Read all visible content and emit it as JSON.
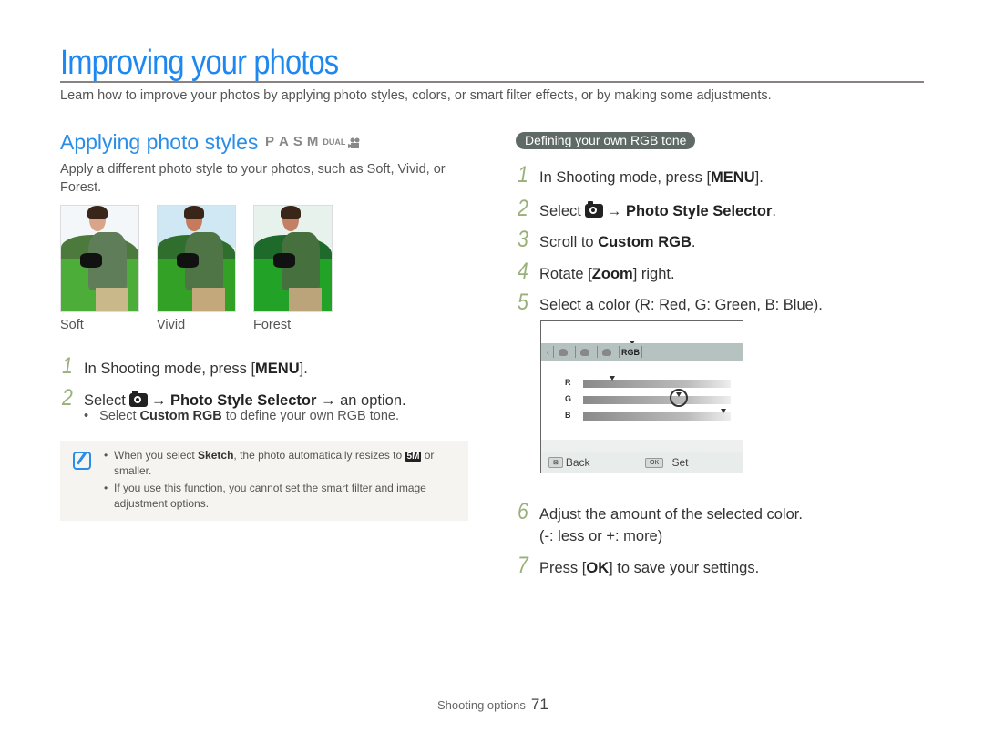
{
  "page": {
    "title": "Improving your photos",
    "intro": "Learn how to improve your photos by applying photo styles, colors, or smart filter effects, or by making some adjustments."
  },
  "section": {
    "title": "Applying photo styles",
    "modes": [
      "P",
      "A",
      "S",
      "M",
      "DUAL",
      "movie-icon"
    ],
    "description": "Apply a different photo style to your photos, such as Soft, Vivid, or Forest.",
    "photos": [
      {
        "label": "Soft",
        "sky": "#f4f7f9",
        "hill": "#4c7a3c",
        "grass": "#4cae38",
        "vest": "#5f7d58",
        "skin": "#d9a58a",
        "pants": "#c8b88a"
      },
      {
        "label": "Vivid",
        "sky": "#cfe8f4",
        "hill": "#2f6e2c",
        "grass": "#32a126",
        "vest": "#4f7446",
        "skin": "#c77b5c",
        "pants": "#c2a87a"
      },
      {
        "label": "Forest",
        "sky": "#e7f2ec",
        "hill": "#1e6a2a",
        "grass": "#22a328",
        "vest": "#46703e",
        "skin": "#c38064",
        "pants": "#bca47a"
      }
    ],
    "steps": [
      {
        "num": "1",
        "pre": "In Shooting mode, press [",
        "bold": "MENU",
        "post": "]."
      },
      {
        "num": "2",
        "pre": "Select",
        "icon": "camera-icon",
        "arrow1": "→",
        "bold": "Photo Style Selector",
        "post": "→ an option."
      }
    ],
    "bullet": {
      "pre": "Select ",
      "bold": "Custom RGB",
      "post": " to define your own RGB tone."
    },
    "notes": [
      {
        "pre": "When you select ",
        "bold": "Sketch",
        "mid": ", the photo automatically resizes to ",
        "icon": "5M",
        "post": " or smaller."
      },
      {
        "text": "If you use this function, you cannot set the smart filter and image adjustment options."
      }
    ]
  },
  "rgb": {
    "pill": "Defining your own RGB tone",
    "steps": [
      {
        "num": "1",
        "pre": "In Shooting mode, press [",
        "bold": "MENU",
        "post": "]."
      },
      {
        "num": "2",
        "pre": "Select",
        "icon": "camera-icon",
        "arrow": "→",
        "bold": "Photo Style Selector",
        "post": "."
      },
      {
        "num": "3",
        "pre": "Scroll to ",
        "bold": "Custom RGB",
        "post": "."
      },
      {
        "num": "4",
        "pre": "Rotate [",
        "bold": "Zoom",
        "post": "] right."
      },
      {
        "num": "5",
        "pre": "Select a color (R: Red, G: Green, B: Blue).",
        "bold": "",
        "post": ""
      },
      {
        "num": "6",
        "line1": "Adjust the amount of the selected color.",
        "line2": "(-: less or +: more)"
      },
      {
        "num": "7",
        "pre": "Press [",
        "bold": "OK",
        "post": "] to save your settings."
      }
    ],
    "screen": {
      "tabs": [
        "CA",
        "CL",
        "m",
        "RGB"
      ],
      "sliders": [
        {
          "label": "R",
          "value": 0.2
        },
        {
          "label": "G",
          "value": 0.65,
          "selected": true
        },
        {
          "label": "B",
          "value": 0.95
        }
      ],
      "back_key": "⊠",
      "back_label": "Back",
      "ok_key": "OK",
      "set_label": "Set"
    }
  },
  "footer": {
    "section": "Shooting options",
    "page": "71"
  }
}
